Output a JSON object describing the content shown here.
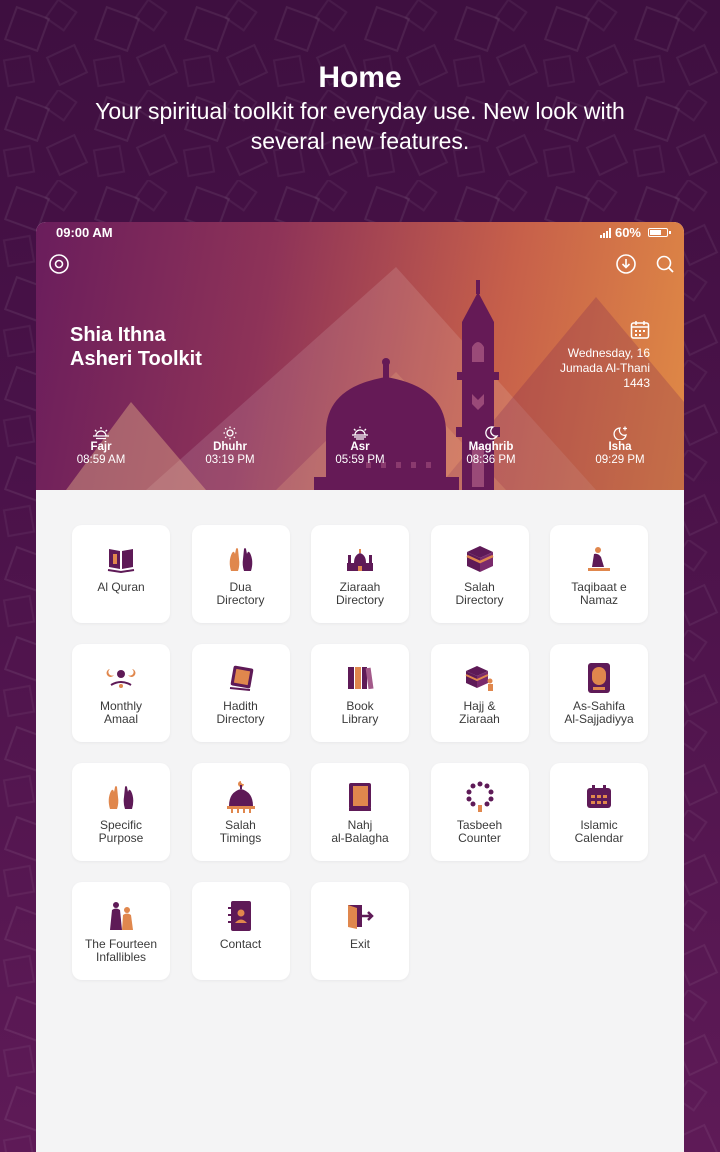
{
  "promo": {
    "title": "Home",
    "subtitle": "Your spiritual toolkit for everyday use. New look with several new features."
  },
  "status_bar": {
    "time": "09:00 AM",
    "battery": "60%"
  },
  "header": {
    "app_title_line1": "Shia Ithna",
    "app_title_line2": "Asheri Toolkit",
    "date_line1": "Wednesday, 16",
    "date_line2": "Jumada Al-Thani",
    "date_line3": "1443",
    "icons": [
      "settings-icon",
      "download-icon",
      "search-icon",
      "calendar-icon"
    ]
  },
  "prayers": [
    {
      "name": "Fajr",
      "time": "08:59 AM",
      "icon": "sunrise-icon"
    },
    {
      "name": "Dhuhr",
      "time": "03:19 PM",
      "icon": "sun-icon"
    },
    {
      "name": "Asr",
      "time": "05:59 PM",
      "icon": "sunset-icon"
    },
    {
      "name": "Maghrib",
      "time": "08:36 PM",
      "icon": "moon-icon"
    },
    {
      "name": "Isha",
      "time": "09:29 PM",
      "icon": "moon-star-icon"
    }
  ],
  "tiles": [
    {
      "label": "Al Quran",
      "icon": "quran-icon"
    },
    {
      "label": "Dua\nDirectory",
      "icon": "dua-hands-icon"
    },
    {
      "label": "Ziaraah\nDirectory",
      "icon": "shrine-icon"
    },
    {
      "label": "Salah\nDirectory",
      "icon": "kaaba-icon"
    },
    {
      "label": "Taqibaat e\nNamaz",
      "icon": "praying-person-icon"
    },
    {
      "label": "Monthly\nAmaal",
      "icon": "moon-phases-icon"
    },
    {
      "label": "Hadith\nDirectory",
      "icon": "hadith-book-icon"
    },
    {
      "label": "Book\nLibrary",
      "icon": "books-icon"
    },
    {
      "label": "Hajj &\nZiaraah",
      "icon": "hajj-icon"
    },
    {
      "label": "As-Sahifa\nAl-Sajjadiyya",
      "icon": "sahifa-book-icon"
    },
    {
      "label": "Specific\nPurpose",
      "icon": "purpose-hands-icon"
    },
    {
      "label": "Salah\nTimings",
      "icon": "mosque-dome-icon"
    },
    {
      "label": "Nahj\nal-Balagha",
      "icon": "nahj-book-icon"
    },
    {
      "label": "Tasbeeh\nCounter",
      "icon": "tasbeeh-icon"
    },
    {
      "label": "Islamic\nCalendar",
      "icon": "islamic-calendar-icon"
    },
    {
      "label": "The Fourteen\nInfallibles",
      "icon": "infallibles-icon"
    },
    {
      "label": "Contact",
      "icon": "contact-book-icon"
    },
    {
      "label": "Exit",
      "icon": "exit-door-icon"
    }
  ],
  "colors": {
    "primary": "#5e1a57",
    "accent": "#e0874d",
    "tile_bg": "#ffffff",
    "content_bg": "#f4f4f5"
  }
}
